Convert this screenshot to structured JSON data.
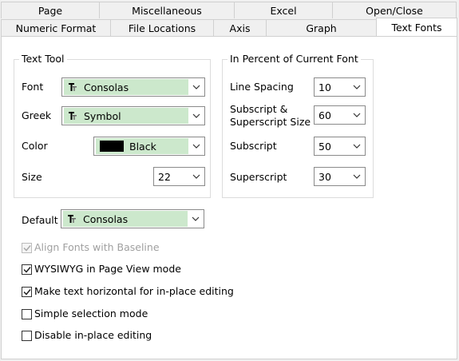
{
  "tabs": {
    "row1": [
      "Page",
      "Miscellaneous",
      "Excel",
      "Open/Close"
    ],
    "row2": [
      "Numeric Format",
      "File Locations",
      "Axis",
      "Graph",
      "Text Fonts"
    ],
    "active": "Text Fonts"
  },
  "text_tool": {
    "title": "Text Tool",
    "font": {
      "label": "Font",
      "value": "Consolas"
    },
    "greek": {
      "label": "Greek",
      "value": "Symbol"
    },
    "color": {
      "label": "Color",
      "value": "Black",
      "swatch": "#000000"
    },
    "size": {
      "label": "Size",
      "value": "22"
    }
  },
  "percent": {
    "title": "In Percent of Current Font",
    "line_spacing": {
      "label": "Line Spacing",
      "value": "10"
    },
    "subsup": {
      "label1": "Subscript &",
      "label2": "Superscript Size",
      "value": "60"
    },
    "subscript": {
      "label": "Subscript",
      "value": "50"
    },
    "superscript": {
      "label": "Superscript",
      "value": "30"
    }
  },
  "default_font": {
    "label": "Default",
    "value": "Consolas"
  },
  "options": [
    {
      "label": "Align Fonts with Baseline",
      "checked": true,
      "disabled": true
    },
    {
      "label": "WYSIWYG in Page View mode",
      "checked": true,
      "disabled": false
    },
    {
      "label": "Make text horizontal for in-place editing",
      "checked": true,
      "disabled": false
    },
    {
      "label": "Simple selection mode",
      "checked": false,
      "disabled": false
    },
    {
      "label": "Disable in-place editing",
      "checked": false,
      "disabled": false
    }
  ],
  "colors": {
    "selection": "#cce8cc",
    "border": "#8a8a8a"
  }
}
